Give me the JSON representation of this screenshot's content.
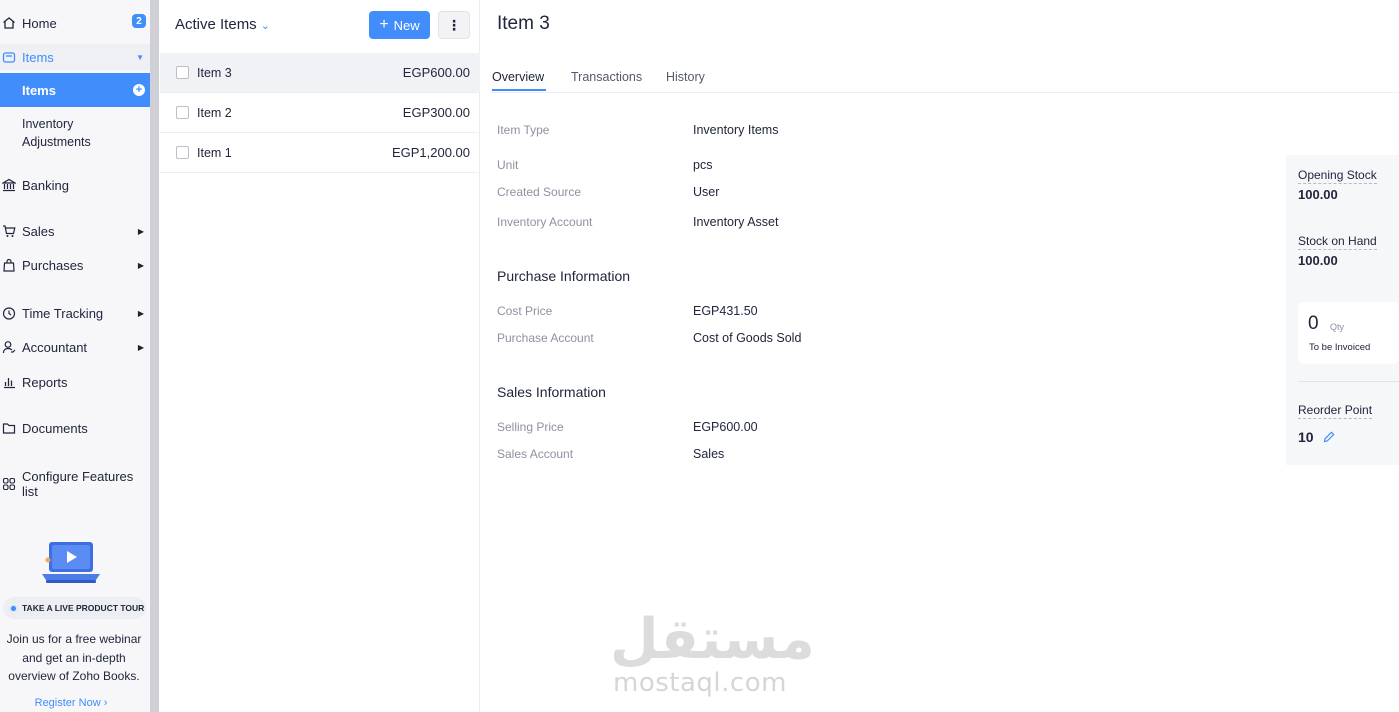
{
  "sidebar": {
    "home": {
      "label": "Home",
      "badge": "2"
    },
    "items_group": {
      "label": "Items"
    },
    "items_sub": {
      "label": "Items"
    },
    "inventory_adjustments": {
      "label_line1": "Inventory",
      "label_line2": "Adjustments"
    },
    "banking": {
      "label": "Banking"
    },
    "sales": {
      "label": "Sales"
    },
    "purchases": {
      "label": "Purchases"
    },
    "time_tracking": {
      "label": "Time Tracking"
    },
    "accountant": {
      "label": "Accountant"
    },
    "reports": {
      "label": "Reports"
    },
    "documents": {
      "label": "Documents"
    },
    "configure": {
      "label": "Configure Features list"
    },
    "promo": {
      "pill": "TAKE A LIVE PRODUCT TOUR",
      "text": "Join us for a free webinar and get an in-depth overview of Zoho Books.",
      "link": "Register Now ›"
    }
  },
  "list": {
    "title": "Active Items",
    "new_label": "New",
    "more_label": "⋮",
    "rows": [
      {
        "name": "Item 3",
        "price": "EGP600.00"
      },
      {
        "name": "Item 2",
        "price": "EGP300.00"
      },
      {
        "name": "Item 1",
        "price": "EGP1,200.00"
      }
    ]
  },
  "detail": {
    "title": "Item 3",
    "tabs": [
      "Overview",
      "Transactions",
      "History"
    ],
    "fields": {
      "item_type": {
        "label": "Item Type",
        "value": "Inventory Items"
      },
      "unit": {
        "label": "Unit",
        "value": "pcs"
      },
      "created_source": {
        "label": "Created Source",
        "value": "User"
      },
      "inventory_account": {
        "label": "Inventory Account",
        "value": "Inventory Asset"
      }
    },
    "purchase": {
      "title": "Purchase Information",
      "cost_price": {
        "label": "Cost Price",
        "value": "EGP431.50"
      },
      "purchase_account": {
        "label": "Purchase Account",
        "value": "Cost of Goods Sold"
      }
    },
    "sales": {
      "title": "Sales Information",
      "selling_price": {
        "label": "Selling Price",
        "value": "EGP600.00"
      },
      "sales_account": {
        "label": "Sales Account",
        "value": "Sales"
      }
    }
  },
  "stats": {
    "opening_stock": {
      "label": "Opening Stock",
      "value": "100.00"
    },
    "stock_on_hand": {
      "label": "Stock on Hand",
      "value": "100.00"
    },
    "to_be_invoiced": {
      "value": "0",
      "unit": "Qty",
      "label": "To be Invoiced"
    },
    "reorder_point": {
      "label": "Reorder Point",
      "value": "10"
    }
  },
  "watermark": {
    "arabic": "مستقل",
    "latin": "mostaql.com"
  },
  "colors": {
    "accent": "#408dfb",
    "text": "#21263c",
    "muted": "#8e91a0"
  }
}
